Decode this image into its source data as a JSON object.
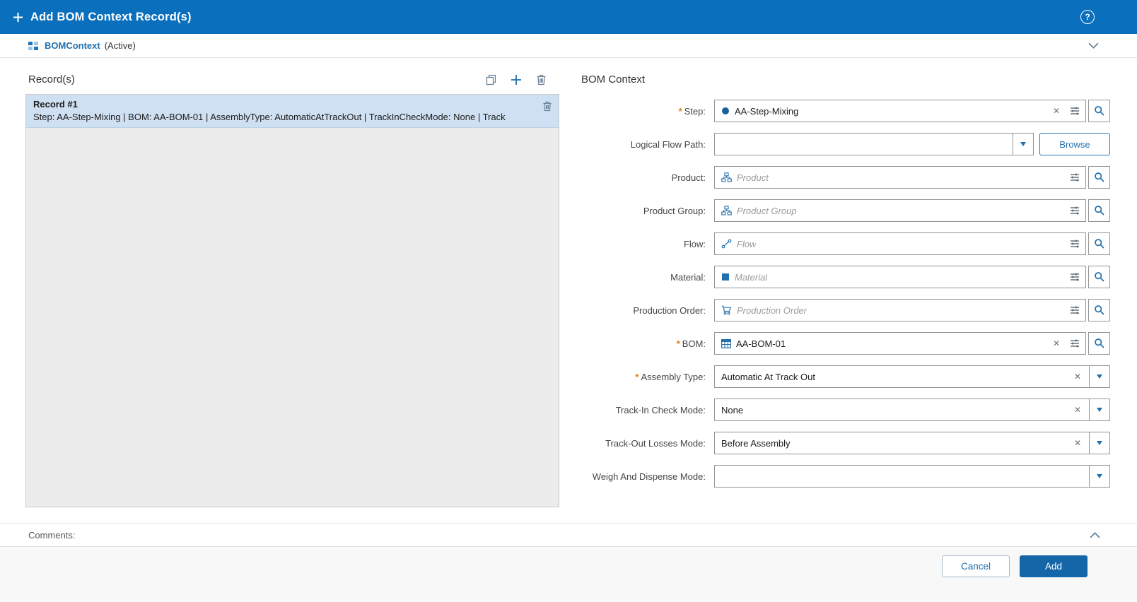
{
  "colors": {
    "header_blue": "#0a6fbd",
    "accent_blue": "#2270ad",
    "add_button_blue": "#1565a9",
    "required_orange": "#de7c0c",
    "selected_record_bg": "#cfe0f2"
  },
  "icons": {
    "help_glyph": "?",
    "clear_glyph": "✕"
  },
  "header": {
    "title": "Add BOM Context Record(s)"
  },
  "context_bar": {
    "entity": "BOMContext",
    "status": "(Active)"
  },
  "records_panel": {
    "title": "Record(s)",
    "records": [
      {
        "title": "Record #1",
        "summary": "Step: AA-Step-Mixing | BOM: AA-BOM-01 | AssemblyType: AutomaticAtTrackOut | TrackInCheckMode: None | Track"
      }
    ]
  },
  "form": {
    "title": "BOM Context",
    "required_marker": "*",
    "fields": [
      {
        "label": "Step:",
        "required": true,
        "value": "AA-Step-Mixing"
      },
      {
        "label": "Logical Flow Path:",
        "value": "",
        "browse_label": "Browse"
      },
      {
        "label": "Product:",
        "placeholder": "Product"
      },
      {
        "label": "Product Group:",
        "placeholder": "Product Group"
      },
      {
        "label": "Flow:",
        "placeholder": "Flow"
      },
      {
        "label": "Material:",
        "placeholder": "Material"
      },
      {
        "label": "Production Order:",
        "placeholder": "Production Order"
      },
      {
        "label": "BOM:",
        "required": true,
        "value": "AA-BOM-01"
      },
      {
        "label": "Assembly Type:",
        "required": true,
        "value": "Automatic At Track Out"
      },
      {
        "label": "Track-In Check Mode:",
        "value": "None"
      },
      {
        "label": "Track-Out Losses Mode:",
        "value": "Before Assembly"
      },
      {
        "label": "Weigh And Dispense Mode:",
        "value": ""
      }
    ]
  },
  "comments": {
    "label": "Comments:"
  },
  "footer": {
    "cancel_label": "Cancel",
    "add_label": "Add"
  }
}
